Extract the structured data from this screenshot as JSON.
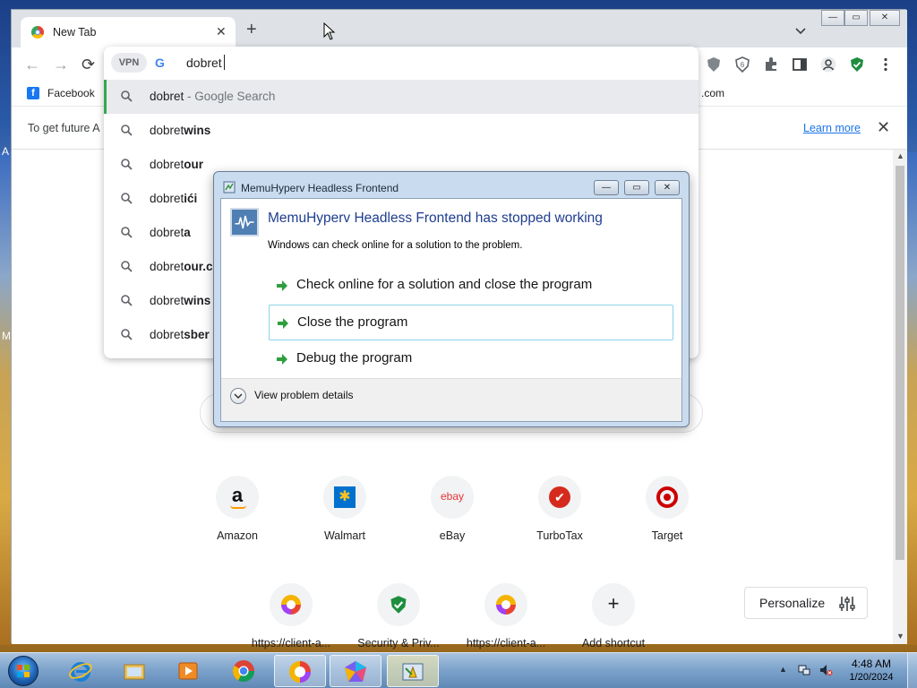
{
  "desktop": {
    "edge_letters": [
      "A",
      "M"
    ]
  },
  "browser": {
    "tab": {
      "title": "New Tab",
      "close": "✕"
    },
    "new_tab": "+",
    "nav": {
      "back": "←",
      "forward": "→",
      "reload": "⟳"
    },
    "bookmarks": {
      "facebook": "Facebook",
      "right_partial": ".com"
    },
    "infobar": {
      "text": "To get future A",
      "learn_more": "Learn more",
      "close": "✕"
    }
  },
  "omnibox": {
    "vpn_label": "VPN",
    "search_engine_icon": "G",
    "input_value": "dobret",
    "suggestions": [
      {
        "prefix": "dobret",
        "bold": "",
        "hint": " - Google Search"
      },
      {
        "prefix": "dobret",
        "bold": "wins",
        "hint": ""
      },
      {
        "prefix": "dobret",
        "bold": "our",
        "hint": ""
      },
      {
        "prefix": "dobret",
        "bold": "ići",
        "hint": ""
      },
      {
        "prefix": "dobret",
        "bold": "a",
        "hint": ""
      },
      {
        "prefix": "dobret",
        "bold": "our.c",
        "hint": ""
      },
      {
        "prefix": "dobret",
        "bold": "wins",
        "hint": ""
      },
      {
        "prefix": "dobret",
        "bold": "sber",
        "hint": ""
      }
    ]
  },
  "shortcuts": {
    "row1": [
      {
        "label": "Amazon",
        "glyph": "a"
      },
      {
        "label": "Walmart",
        "glyph": "✱"
      },
      {
        "label": "eBay",
        "glyph": "ebay"
      },
      {
        "label": "TurboTax",
        "glyph": "✔"
      },
      {
        "label": "Target",
        "glyph": "◎"
      }
    ],
    "row2": [
      {
        "label": "https://client-a...",
        "glyph": ""
      },
      {
        "label": "Security & Priv...",
        "glyph": ""
      },
      {
        "label": "https://client-a...",
        "glyph": ""
      },
      {
        "label": "Add shortcut",
        "glyph": "+"
      }
    ]
  },
  "personalize": {
    "label": "Personalize"
  },
  "dialog": {
    "title": "MemuHyperv Headless Frontend",
    "heading": "MemuHyperv Headless Frontend has stopped working",
    "subtext": "Windows can check online for a solution to the problem.",
    "options": [
      "Check online for a solution and close the program",
      "Close the program",
      "Debug the program"
    ],
    "details_label": "View problem details",
    "buttons": {
      "minimize": "—",
      "maximize": "▭",
      "close": "✕"
    }
  },
  "taskbar": {
    "clock_time": "4:48 AM",
    "clock_date": "1/20/2024"
  },
  "colors": {
    "accent_blue": "#1a73e8",
    "dialog_heading": "#1e3d8f",
    "selected_bar": "#34a853"
  }
}
